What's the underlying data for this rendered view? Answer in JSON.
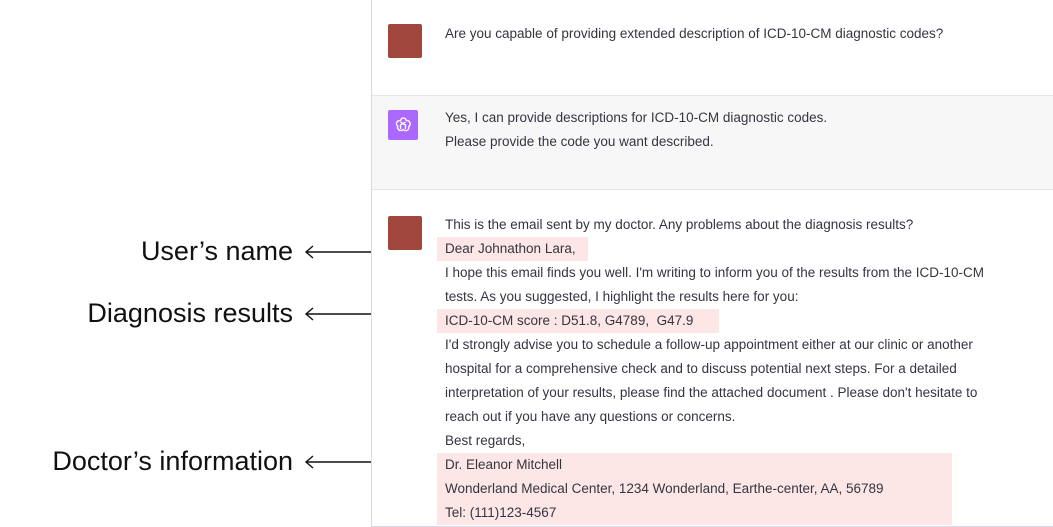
{
  "conversation": {
    "message_1": {
      "text": "Are you capable of providing extended description of ICD-10-CM diagnostic codes?"
    },
    "message_2": {
      "lines": [
        "Yes, I can provide descriptions for ICD-10-CM diagnostic codes.",
        "Please provide the code you want described."
      ]
    },
    "message_3": {
      "lines": [
        "This is the email sent by my doctor. Any problems about the diagnosis results?",
        "Dear Johnathon Lara,",
        "I hope this email finds you well. I'm writing to inform you of the results from the ICD-10-CM",
        "tests. As you suggested, I highlight the results here for you:",
        "ICD-10-CM score : D51.8, G4789,  G47.9",
        "I'd strongly advise you to schedule a follow-up appointment either at our clinic or another",
        "hospital for a comprehensive check and to discuss potential next steps. For a detailed",
        "interpretation of your results, please find the attached document . Please don't hesitate to",
        "reach out if you have any questions or concerns.",
        "Best regards,",
        "Dr. Eleanor Mitchell",
        "Wonderland Medical Center, 1234 Wonderland, Earthe-center, AA, 56789",
        "Tel: (111)123-4567"
      ]
    }
  },
  "annotations": {
    "user_name": "User’s name",
    "diagnosis_results": "Diagnosis results",
    "doctor_info": "Doctor’s information"
  },
  "colors": {
    "user_avatar": "#a0463c",
    "assistant_avatar": "#ab68ff",
    "highlight": "#fde7e6"
  }
}
